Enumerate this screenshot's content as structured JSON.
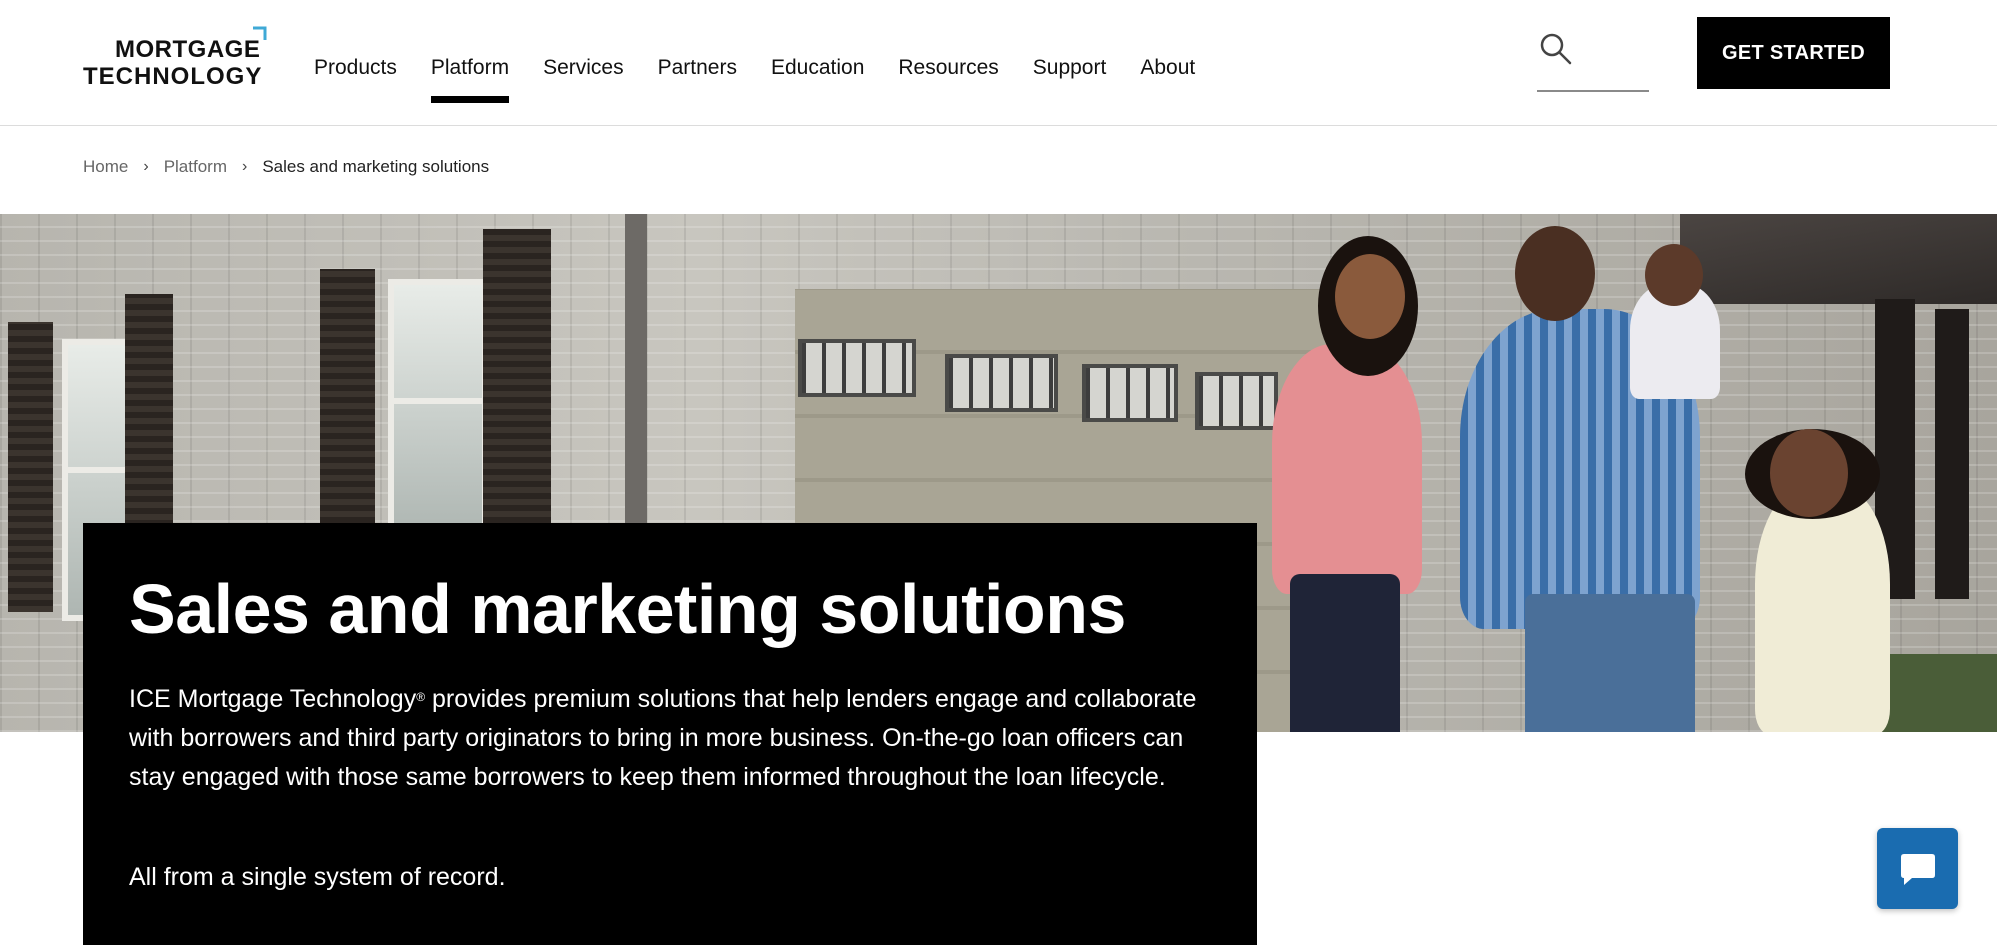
{
  "brand": {
    "logo_line1": "MORTGAGE",
    "logo_line2": "TECHNOLOGY",
    "accent_color": "#3fa9d6"
  },
  "nav": {
    "items": [
      {
        "label": "Products"
      },
      {
        "label": "Platform",
        "active": true
      },
      {
        "label": "Services"
      },
      {
        "label": "Partners"
      },
      {
        "label": "Education"
      },
      {
        "label": "Resources"
      },
      {
        "label": "Support"
      },
      {
        "label": "About"
      }
    ]
  },
  "header": {
    "search_icon": "search-icon",
    "cta_label": "GET STARTED"
  },
  "breadcrumb": {
    "home": "Home",
    "parent": "Platform",
    "current": "Sales and marketing solutions",
    "separator": "›"
  },
  "hero": {
    "title": "Sales and marketing solutions",
    "body_part1": "ICE Mortgage Technology",
    "body_reg": "®",
    "body_part2": " provides premium solutions that help lenders engage and collaborate with borrowers and third party originators to bring in more business. On-the-go loan officers can stay engaged with those same borrowers to keep them informed throughout the loan lifecycle.",
    "tagline": "All from a single system of record."
  },
  "chat": {
    "icon": "chat-bubble-icon",
    "color": "#1a6cb0"
  }
}
